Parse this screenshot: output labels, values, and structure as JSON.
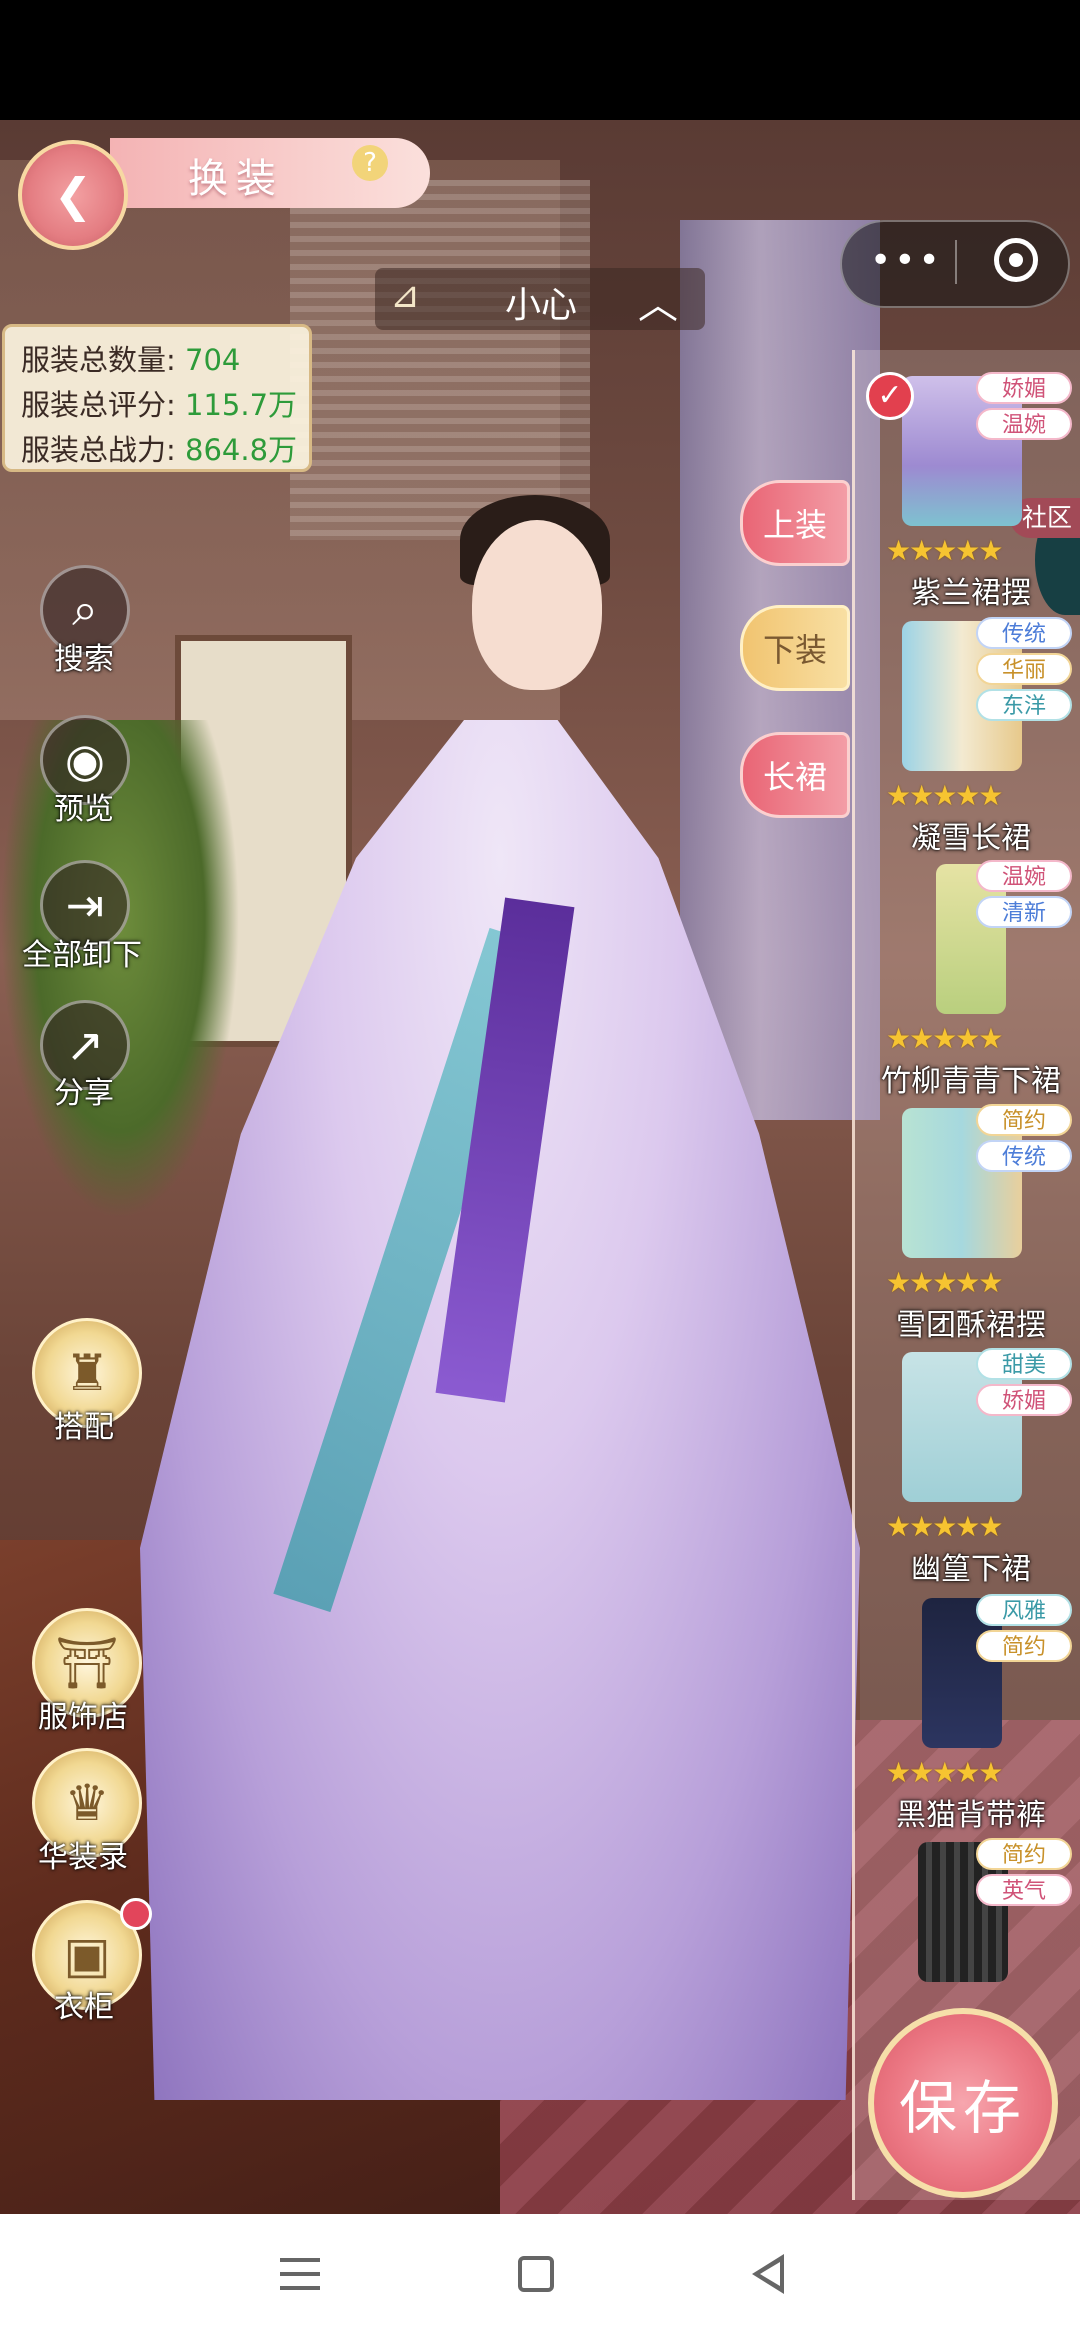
{
  "header": {
    "title": "换装",
    "help_icon": "?",
    "back_icon": "back-arrow-icon"
  },
  "character": {
    "name": "小心"
  },
  "stats": {
    "count_label": "服装总数量:",
    "count_value": "704",
    "score_label": "服装总评分:",
    "score_value": "115.7万",
    "power_label": "服装总战力:",
    "power_value": "864.8万"
  },
  "left_menu": [
    {
      "label": "搜索",
      "icon": "search-icon"
    },
    {
      "label": "预览",
      "icon": "eye-icon"
    },
    {
      "label": "全部卸下",
      "icon": "unequip-icon"
    },
    {
      "label": "分享",
      "icon": "share-icon"
    },
    {
      "label": "搭配",
      "icon": "outfit-icon"
    },
    {
      "label": "服饰店",
      "icon": "shop-icon"
    },
    {
      "label": "华装录",
      "icon": "catalog-icon"
    },
    {
      "label": "衣柜",
      "icon": "wardrobe-icon"
    }
  ],
  "category_tabs": [
    "上装",
    "下装",
    "长裙"
  ],
  "community_label": "社区",
  "items": [
    {
      "name": "紫兰裙摆",
      "stars": "★★★★★",
      "tags": [
        "娇媚",
        "温婉"
      ],
      "selected": true
    },
    {
      "name": "凝雪长裙",
      "stars": "★★★★★",
      "tags": [
        "传统",
        "华丽",
        "东洋"
      ]
    },
    {
      "name": "竹柳青青下裙",
      "stars": "★★★★★",
      "tags": [
        "温婉",
        "清新"
      ]
    },
    {
      "name": "雪团酥裙摆",
      "stars": "★★★★★",
      "tags": [
        "简约",
        "传统"
      ]
    },
    {
      "name": "幽篁下裙",
      "stars": "★★★★★",
      "tags": [
        "甜美",
        "娇媚"
      ]
    },
    {
      "name": "黑猫背带裤",
      "stars": "★★★★★",
      "tags": [
        "风雅",
        "简约"
      ]
    },
    {
      "name": "",
      "stars": "",
      "tags": [
        "简约",
        "英气"
      ]
    }
  ],
  "save_label": "保存",
  "colors": {
    "accent_pink": "#e96575",
    "gold": "#f1d892",
    "stat_green": "#2e9b3a"
  }
}
